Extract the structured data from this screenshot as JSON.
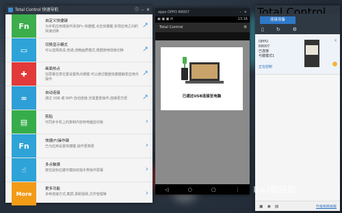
{
  "shortcuts": {
    "title": "Total Control 快速导航",
    "items": [
      {
        "icon_text": "Fn",
        "color": "#3cae4c",
        "title": "自定义快捷键",
        "desc": "为手机应用或操作添加Fn 快捷键,点击快捷键,实现应用之间的快速切换"
      },
      {
        "icon_text": "",
        "color": "#2ea3d8",
        "title": "切换显示模式",
        "desc": "可以选择高清,普通,流畅画质模式,根据使用场景切换"
      },
      {
        "icon_text": "✚",
        "color": "#e23a3a",
        "title": "画面热点",
        "desc": "在屏幕任意位置设置热点按键,可以通过键盘快捷键触发应用内操作"
      },
      {
        "icon_text": "",
        "color": "#2e9fd6",
        "title": "自动连接",
        "desc": "通过 USB 或 WiFi 自动连接,无需重复操作,连接更方便"
      },
      {
        "icon_text": "",
        "color": "#36ad4a",
        "title": "剪贴",
        "desc": "可同步手机上的复制内容到电脑剪切板"
      },
      {
        "icon_text": "Fn",
        "color": "#2ea3d8",
        "title": "快捷(F)操作键",
        "desc": "已为应用设置快捷键,操作更简便"
      },
      {
        "icon_text": "",
        "color": "#2ea3d8",
        "title": "多点触摸",
        "desc": "按住鼠标右键可模拟双指手势操作屏幕"
      },
      {
        "icon_text": "More",
        "color": "#f29b16",
        "title": "更多功能",
        "desc": "多种连接方式,截屏,录制视频,文件管理等"
      }
    ]
  },
  "phone": {
    "window_title": "oppo OPPO R8007",
    "status_time": "13:16",
    "app_title": "Total Control",
    "card_caption": "已通过USB连接至电脑"
  },
  "tc": {
    "title": "Total Control",
    "connect_label": "连接设备",
    "device": {
      "brand": "OPPO",
      "model": "R8007",
      "state": "已连接",
      "mode": "与键模式1",
      "link": "正在控制"
    },
    "buy_label": "升级到高级版"
  },
  "watermark": "Bai图经验"
}
